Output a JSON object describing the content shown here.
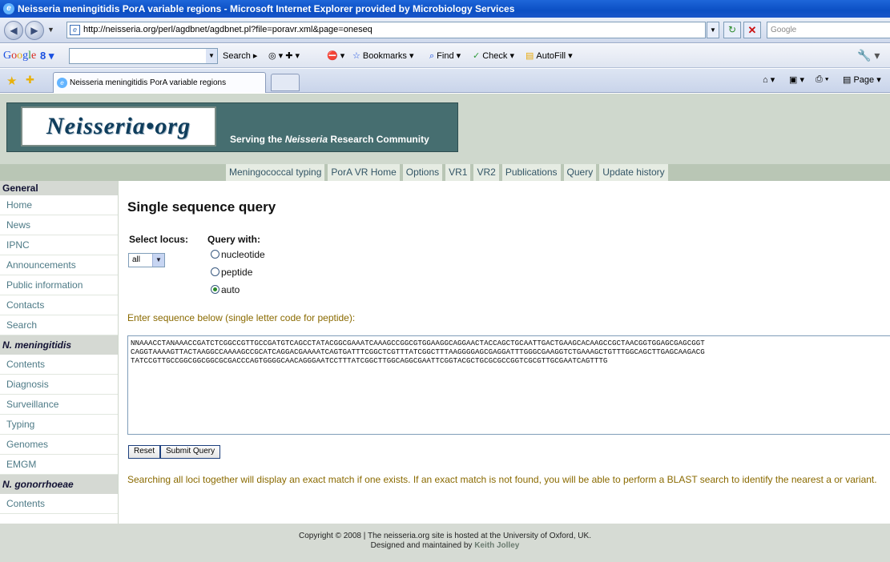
{
  "window": {
    "title": "Neisseria meningitidis PorA variable regions - Microsoft Internet Explorer provided by Microbiology Services"
  },
  "address_bar": {
    "url": "http://neisseria.org/perl/agdbnet/agdbnet.pl?file=poravr.xml&page=oneseq",
    "search_placeholder": "Google"
  },
  "google_toolbar": {
    "logo": "Google",
    "search_label": "Search",
    "bookmarks_label": "Bookmarks",
    "find_label": "Find",
    "check_label": "Check",
    "autofill_label": "AutoFill"
  },
  "tabs": {
    "active_tab": "Neisseria meningitidis PorA variable regions",
    "page_label": "Page"
  },
  "header": {
    "logo": "Neisseria•org",
    "tagline_prefix": "Serving the ",
    "tagline_italic": "Neisseria",
    "tagline_suffix": " Research Community"
  },
  "nav": [
    "Meningococcal typing",
    "PorA VR Home",
    "Options",
    "VR1",
    "VR2",
    "Publications",
    "Query",
    "Update history"
  ],
  "sidebar": {
    "general_heading": "General",
    "general_items": [
      "Home",
      "News",
      "IPNC",
      "Announcements",
      "Public information",
      "Contacts",
      "Search"
    ],
    "meningitidis_heading": "N. meningitidis",
    "meningitidis_items": [
      "Contents",
      "Diagnosis",
      "Surveillance",
      "Typing",
      "Genomes",
      "EMGM"
    ],
    "gonorrhoeae_heading": "N. gonorrhoeae",
    "gonorrhoeae_items": [
      "Contents"
    ]
  },
  "main": {
    "title": "Single sequence query",
    "select_locus_label": "Select locus:",
    "query_with_label": "Query with:",
    "locus_value": "all",
    "query_options": [
      "nucleotide",
      "peptide",
      "auto"
    ],
    "query_selected": "auto",
    "hint": "Enter sequence below (single letter code for peptide):",
    "sequence": "NNAAACCTANAAACCGATCTCGGCCGTTGCCGATGTCAGCCTATACGGCGAAATCAAAGCCGGCGTGGAAGGCAGGAACTACCAGCTGCAATTGACTGAAGCACAAGCCGCTAACGGTGGAGCGAGCGGT\nCAGGTAAAAGTTACTAAGGCCAAAAGCCGCATCAGGACGAAAATCAGTGATTTCGGCTCGTTTATCGGCTTTAAGGGGAGCGAGGATTTGGGCGAAGGTCTGAAAGCTGTTTGGCAGCTTGAGCAAGACG\nTATCCGTTGCCGGCGGCGGCGCGACCCAGTGGGGCAACAGGGAATCCTTTATCGGCTTGGCAGGCGAATTCGGTACGCTGCGCGCCGGTCGCGTTGCGAATCAGTTTG",
    "reset_label": "Reset",
    "submit_label": "Submit Query",
    "note": "Searching all loci together will display an exact match if one exists. If an exact match is not found, you will be able to perform a BLAST search to identify the nearest a or variant."
  },
  "footer": {
    "line1": "Copyright © 2008 | The neisseria.org site is hosted at the University of Oxford, UK.",
    "line2_prefix": "Designed and maintained by ",
    "line2_name": "Keith Jolley"
  }
}
